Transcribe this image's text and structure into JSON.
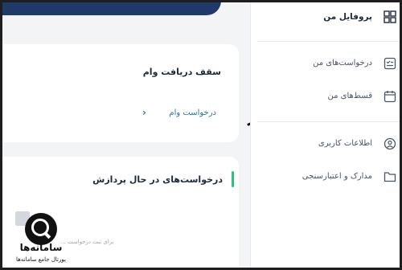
{
  "sidebar": {
    "profile": {
      "label": "پروفایل من",
      "icon": "dashboard-grid-icon"
    },
    "items": [
      {
        "label": "درخواست‌های من",
        "icon": "checklist-icon"
      },
      {
        "label": "قسط‌های من",
        "icon": "calendar-icon"
      },
      {
        "label": "اطلاعات کاربری",
        "icon": "user-circle-icon"
      },
      {
        "label": "مدارک و اعتبارسنجی",
        "icon": "folder-icon"
      }
    ]
  },
  "loan_card": {
    "title": "سقف دریافت وام",
    "link_label": "درخواست وام"
  },
  "processing_card": {
    "title": "درخواست‌های در حال پردازش",
    "empty_text": "برای ثبت درخواست ..."
  },
  "watermark": {
    "name": "سامانه‌ها",
    "subtitle": "پورتال جامع سامانه‌ها"
  },
  "colors": {
    "banner": "#1f3a68",
    "accent": "#2b7a8c",
    "status_green": "#2ec07e"
  }
}
